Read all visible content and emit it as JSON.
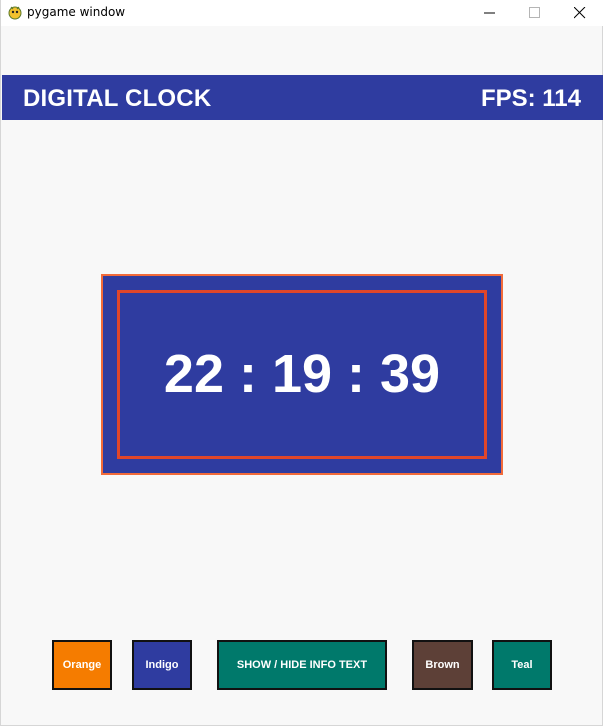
{
  "window": {
    "title": "pygame window",
    "icon": "pygame-snake-icon"
  },
  "header": {
    "title": "DIGITAL CLOCK",
    "fps": "FPS: 114"
  },
  "clock": {
    "time": "22 : 19 : 39"
  },
  "buttons": {
    "orange": "Orange",
    "indigo": "Indigo",
    "info": "SHOW / HIDE INFO TEXT",
    "brown": "Brown",
    "teal": "Teal"
  },
  "colors": {
    "indigo": "#2f3ca0",
    "orange": "#f57c00",
    "teal": "#00796b",
    "brown": "#5d4037",
    "clock_border_outer": "#f26b3a",
    "clock_border_inner": "#e0462a",
    "background": "#f8f8f8"
  }
}
